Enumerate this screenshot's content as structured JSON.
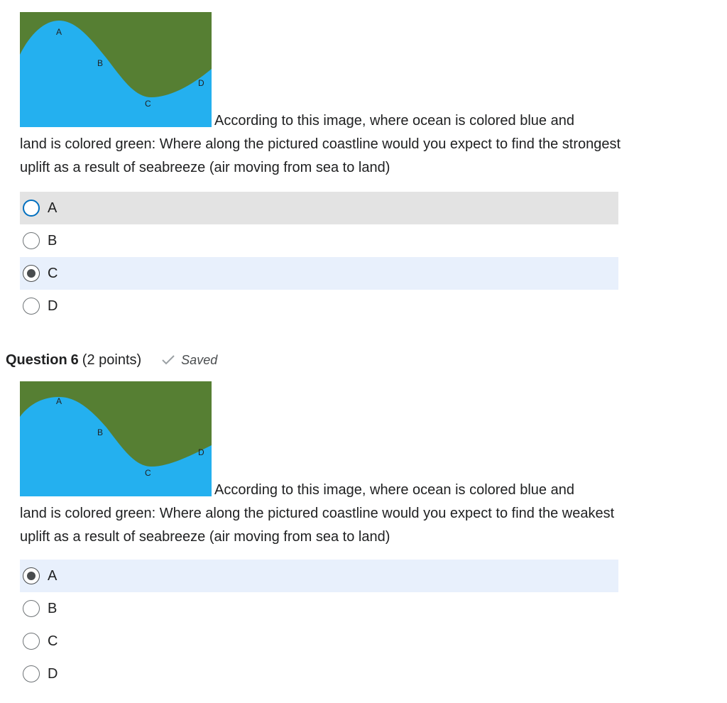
{
  "questions": [
    {
      "header": null,
      "map": {
        "labels": [
          "A",
          "B",
          "C",
          "D"
        ],
        "ocean_color": "#24b0ef",
        "land_color": "#567f33"
      },
      "prompt_first_line": "According to this image, where ocean is colored blue and",
      "prompt_rest": "land is colored green: Where along the pictured coastline would you expect to find the strongest uplift as a result of seabreeze (air moving from sea to land)",
      "options": [
        {
          "label": "A",
          "state": "hover"
        },
        {
          "label": "B",
          "state": "none"
        },
        {
          "label": "C",
          "state": "selected"
        },
        {
          "label": "D",
          "state": "none"
        }
      ]
    },
    {
      "header": {
        "word": "Question",
        "number": "6",
        "points": "(2 points)",
        "status": "Saved"
      },
      "map": {
        "labels": [
          "A",
          "B",
          "C",
          "D"
        ],
        "ocean_color": "#24b0ef",
        "land_color": "#567f33"
      },
      "prompt_first_line": "According to this image, where ocean is colored blue and",
      "prompt_rest": "land is colored green: Where along the pictured coastline would you expect to find the weakest uplift as a result of seabreeze (air moving from sea to land)",
      "options": [
        {
          "label": "A",
          "state": "selected"
        },
        {
          "label": "B",
          "state": "none"
        },
        {
          "label": "C",
          "state": "none"
        },
        {
          "label": "D",
          "state": "none"
        }
      ]
    }
  ],
  "icons": {
    "saved": "checkmark-icon"
  }
}
